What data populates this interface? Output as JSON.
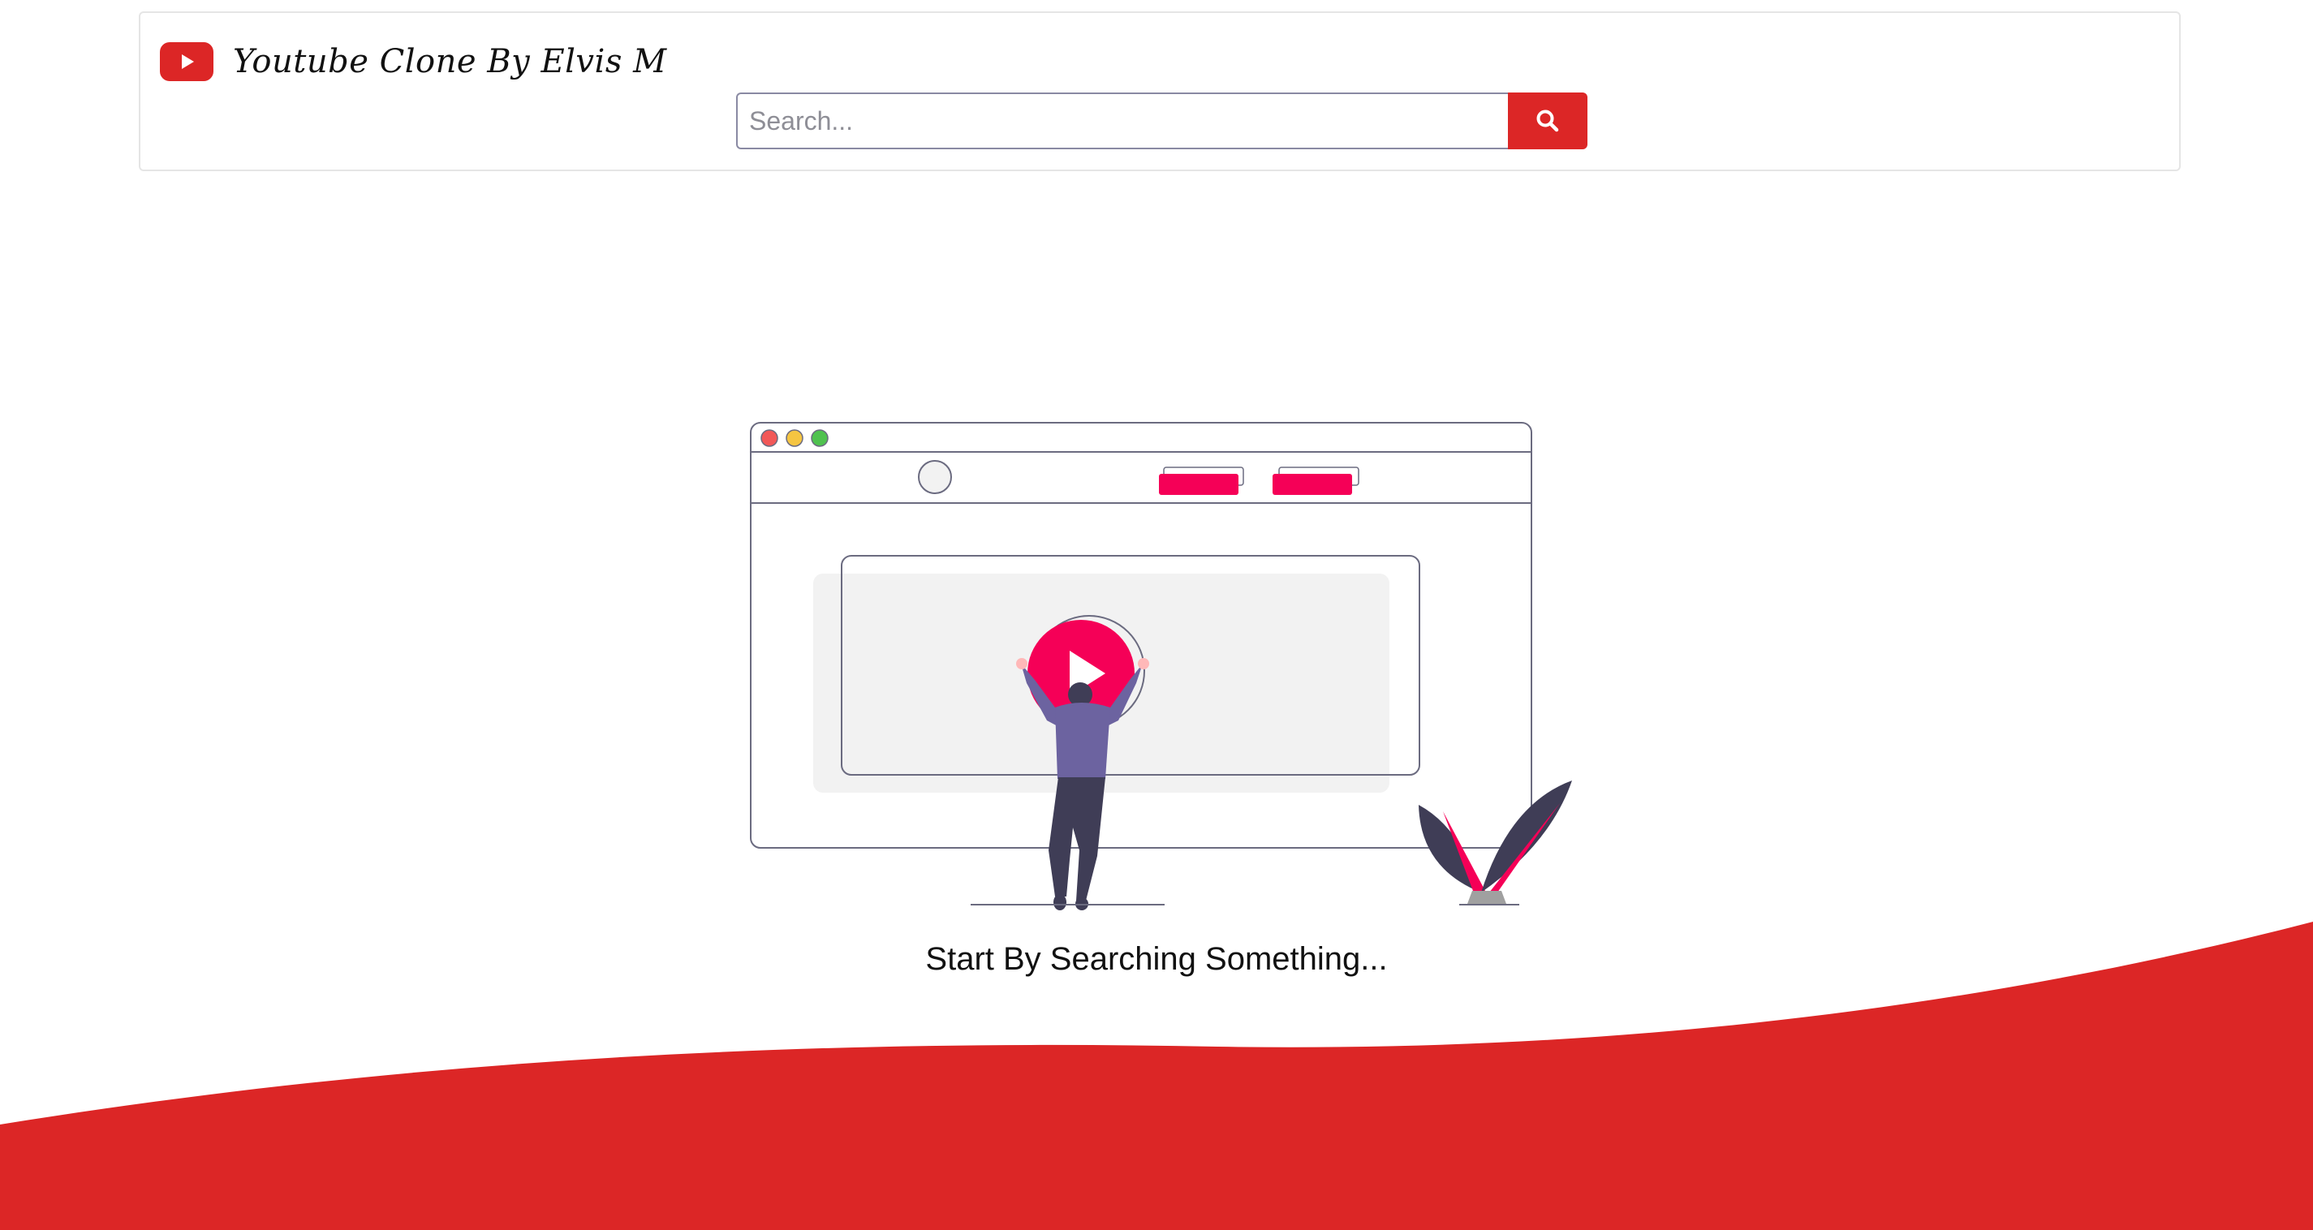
{
  "header": {
    "logo_icon": "youtube-play-icon",
    "title": "Youtube Clone By Elvis M"
  },
  "search": {
    "placeholder": "Search...",
    "value": "",
    "button_icon": "search-icon"
  },
  "main": {
    "illustration": "person-playing-video-illustration",
    "prompt_text": "Start By Searching Something..."
  },
  "colors": {
    "brand_red": "#dc2626",
    "accent_pink": "#f50057",
    "figure_dark": "#3f3d56"
  }
}
